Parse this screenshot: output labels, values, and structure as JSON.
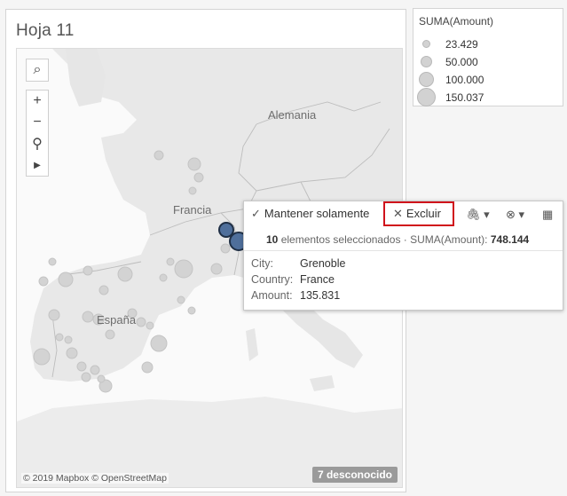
{
  "sheet": {
    "title": "Hoja 11"
  },
  "map": {
    "country_labels": {
      "germany": "Alemania",
      "france": "Francia",
      "spain": "España"
    },
    "attribution": "© 2019 Mapbox © OpenStreetMap",
    "unknown_badge": "7 desconocido",
    "controls": {
      "search": "⌕",
      "zoom_in": "+",
      "zoom_out": "−",
      "pin": "⚲",
      "more": "▶"
    }
  },
  "legend": {
    "title": "SUMA(Amount)",
    "entries": [
      {
        "label": "23.429"
      },
      {
        "label": "50.000"
      },
      {
        "label": "100.000"
      },
      {
        "label": "150.037"
      }
    ]
  },
  "tooltip": {
    "keep_only": {
      "glyph": "✓",
      "label": "Mantener solamente"
    },
    "exclude": {
      "glyph": "✕",
      "label": "Excluir"
    },
    "icons": {
      "group": "🖇 ▾",
      "sets": "⊗ ▾",
      "view_data": "▦"
    },
    "summary": {
      "count": "10",
      "count_text": "elementos seleccionados",
      "separator": "·",
      "measure_label": "SUMA(Amount):",
      "measure_value": "748.144"
    },
    "fields": [
      {
        "name": "City:",
        "value": "Grenoble"
      },
      {
        "name": "Country:",
        "value": "France"
      },
      {
        "name": "Amount:",
        "value": "135.831"
      }
    ]
  },
  "colors": {
    "selected_mark": "#4f6f9b",
    "mark": "#d3d3d3",
    "exclude_highlight": "#d0121b"
  }
}
